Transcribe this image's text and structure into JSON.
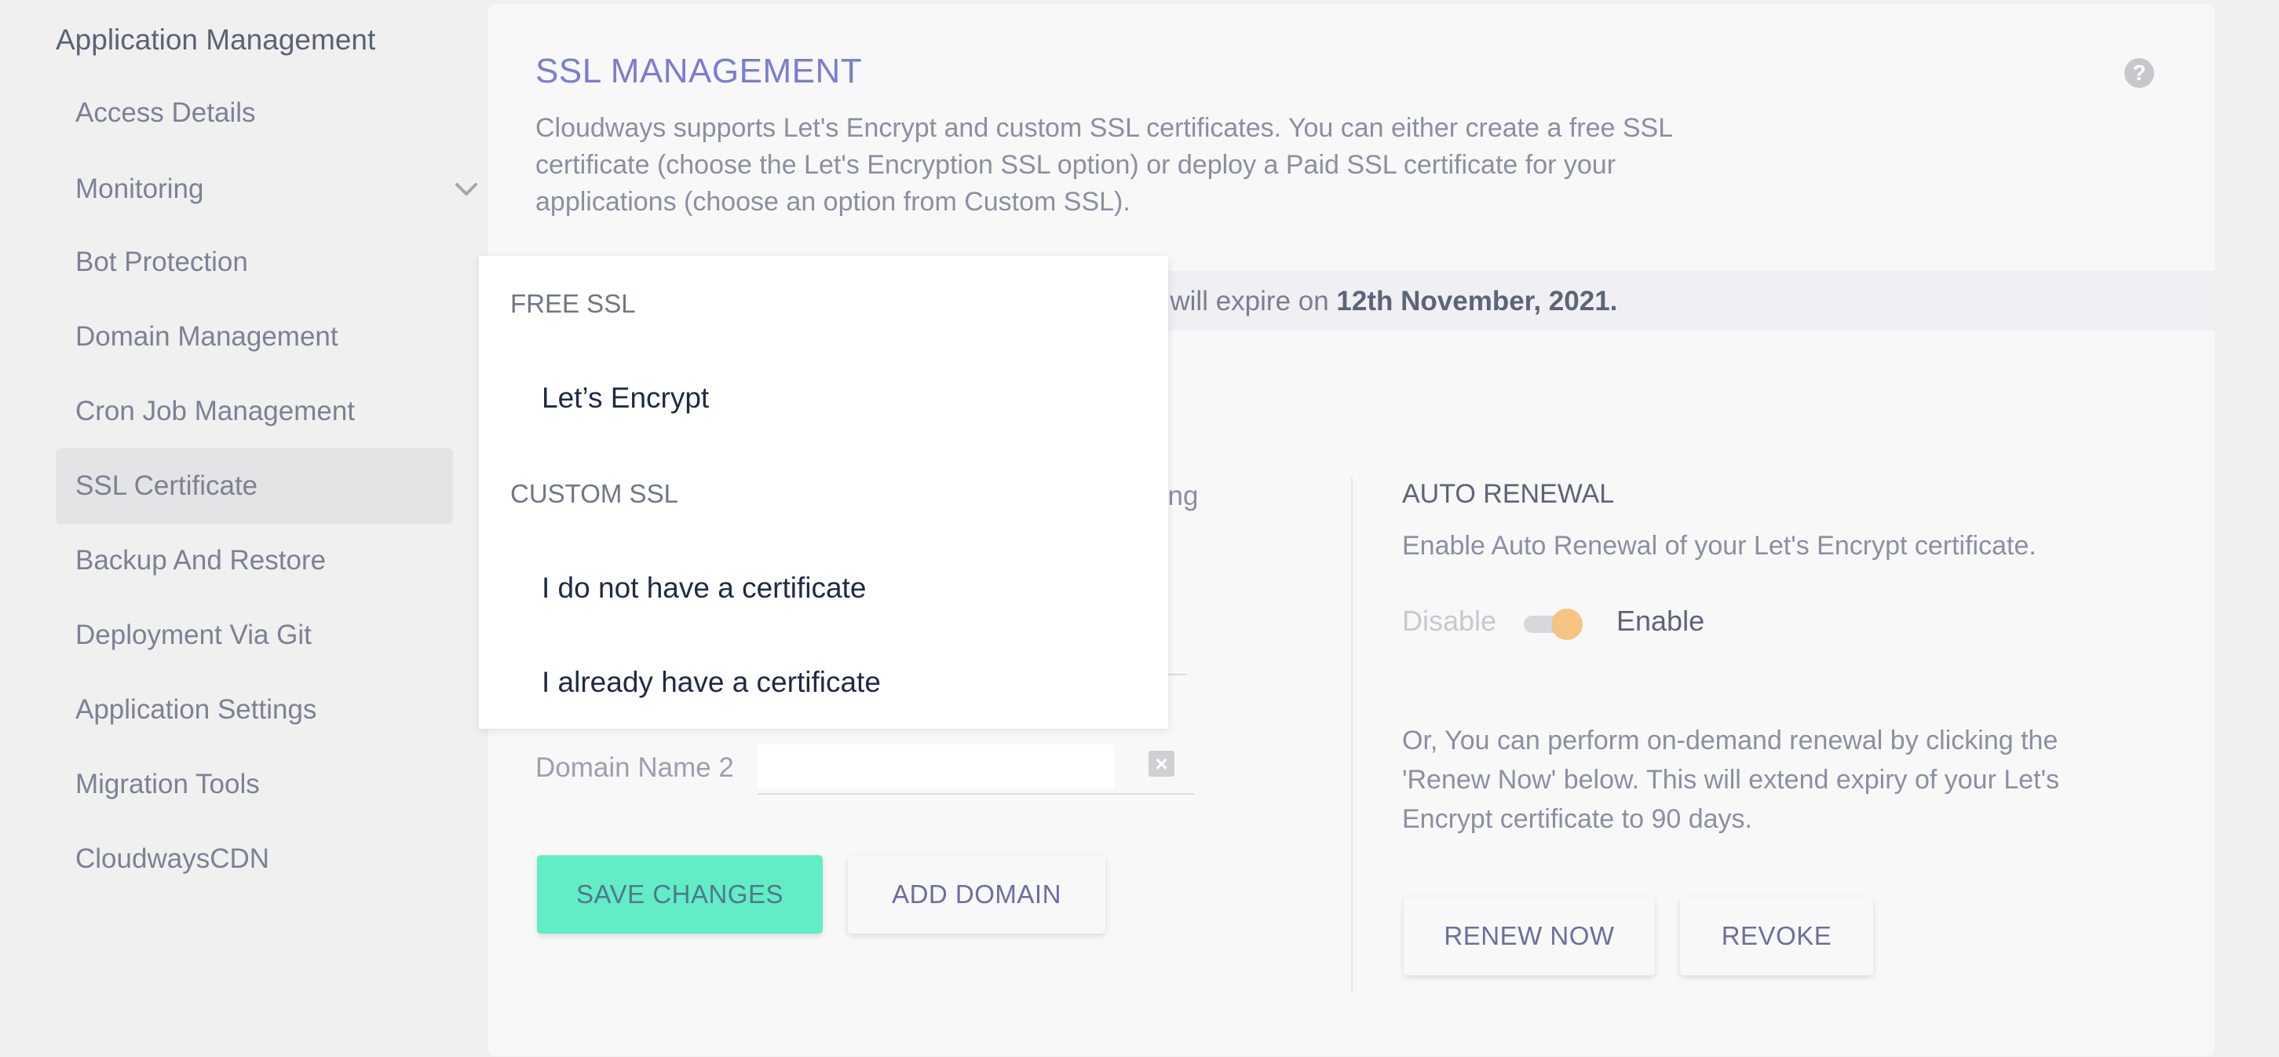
{
  "sidebar": {
    "title": "Application Management",
    "items": [
      {
        "label": "Access Details"
      },
      {
        "label": "Monitoring"
      },
      {
        "label": "Bot Protection"
      },
      {
        "label": "Domain Management"
      },
      {
        "label": "Cron Job Management"
      },
      {
        "label": "SSL Certificate"
      },
      {
        "label": "Backup And Restore"
      },
      {
        "label": "Deployment Via Git"
      },
      {
        "label": "Application Settings"
      },
      {
        "label": "Migration Tools"
      },
      {
        "label": "CloudwaysCDN"
      }
    ],
    "active_item": "SSL Certificate"
  },
  "main": {
    "title": "SSL MANAGEMENT",
    "help_icon": "?",
    "description": "Cloudways supports Let's Encrypt and custom SSL certificates. You can either create a free SSL certificate (choose the Let's Encryption SSL option) or deploy a Paid SSL certificate for your applications (choose an option from Custom SSL).",
    "info_prefix": "ate will expire on ",
    "info_date": "12th November, 2021.",
    "setting_fragment": "ting",
    "domain2_label": "Domain Name 2",
    "domain2_value": "",
    "clear_icon": "×",
    "save_button": "SAVE CHANGES",
    "add_domain_button": "ADD DOMAIN"
  },
  "auto_renewal": {
    "title": "AUTO RENEWAL",
    "description": "Enable Auto Renewal of your Let's Encrypt certificate.",
    "toggle_off_label": "Disable",
    "toggle_on_label": "Enable",
    "toggle_state": "enabled",
    "renew_description": "Or, You can perform on-demand renewal by clicking the 'Renew Now' below. This will extend expiry of your Let's Encrypt certificate to 90 days.",
    "renew_button": "RENEW NOW",
    "revoke_button": "REVOKE"
  },
  "dropdown": {
    "groups": [
      {
        "label": "FREE SSL",
        "options": [
          "Let’s Encrypt"
        ]
      },
      {
        "label": "CUSTOM SSL",
        "options": [
          "I do not have a certificate",
          "I already have a certificate"
        ]
      }
    ]
  },
  "colors": {
    "accent_title": "#7b7ecf",
    "save_button": "#62edc6",
    "toggle_knob": "#f5c382"
  }
}
